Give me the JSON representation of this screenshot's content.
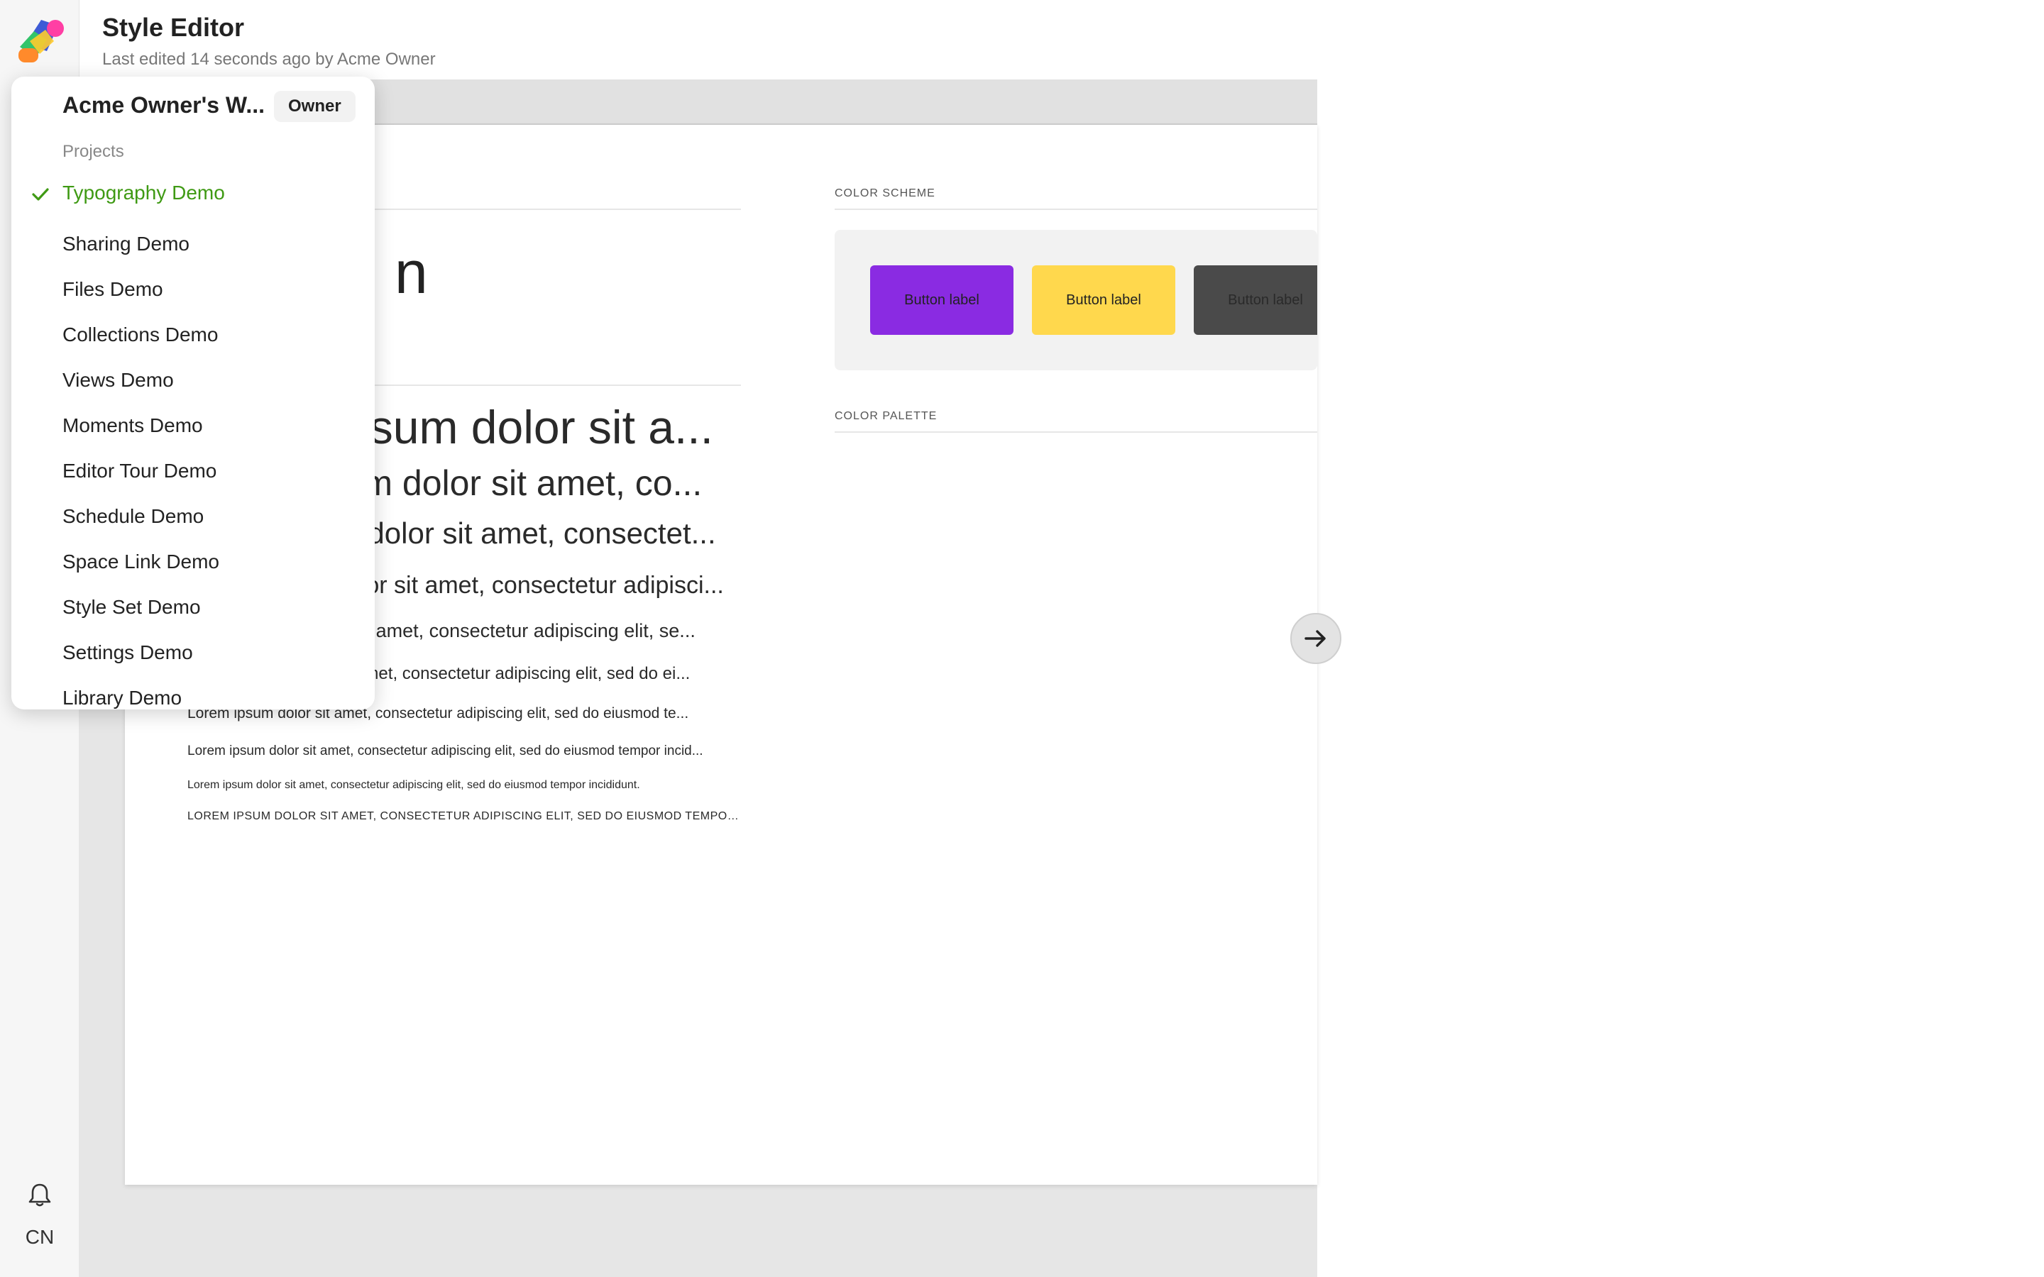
{
  "header": {
    "title": "Style Editor",
    "subtitle": "Last edited 14 seconds ago by Acme Owner"
  },
  "rail": {
    "initials": "CN"
  },
  "workspace_menu": {
    "workspace_name": "Acme Owner's W...",
    "role_badge": "Owner",
    "section_label": "Projects",
    "items": [
      {
        "label": "Typography Demo",
        "selected": true
      },
      {
        "label": "Sharing Demo"
      },
      {
        "label": "Files Demo"
      },
      {
        "label": "Collections Demo"
      },
      {
        "label": "Views Demo"
      },
      {
        "label": "Moments Demo"
      },
      {
        "label": "Editor Tour Demo"
      },
      {
        "label": "Schedule Demo"
      },
      {
        "label": "Space Link Demo"
      },
      {
        "label": "Style Set Demo"
      },
      {
        "label": "Settings Demo"
      },
      {
        "label": "Library Demo"
      }
    ]
  },
  "typography": {
    "glyph": "n",
    "samples": [
      "Lorem ipsum dolor sit a...",
      "Lorem ipsum dolor sit amet, co...",
      "Lorem ipsum dolor sit amet, consectet...",
      "Lorem ipsum dolor sit amet, consectetur adipisci...",
      "Lorem ipsum dolor sit amet, consectetur adipiscing elit, se...",
      "Lorem ipsum dolor sit amet, consectetur adipiscing elit, sed do ei...",
      "Lorem ipsum dolor sit amet, consectetur adipiscing elit, sed do eiusmod te...",
      "Lorem ipsum dolor sit amet, consectetur adipiscing elit, sed do eiusmod tempor incid...",
      "Lorem ipsum dolor sit amet, consectetur adipiscing elit, sed do eiusmod tempor incididunt.",
      "LOREM IPSUM DOLOR SIT AMET, CONSECTETUR ADIPISCING ELIT, SED DO EIUSMOD TEMPOR..."
    ]
  },
  "color_scheme": {
    "label": "COLOR SCHEME",
    "buttons": [
      {
        "label": "Button label",
        "bg": "#8a2be2"
      },
      {
        "label": "Button label",
        "bg": "#ffd84d"
      },
      {
        "label": "Button label",
        "bg": "#4a4a4a"
      }
    ]
  },
  "color_palette": {
    "label": "COLOR PALETTE"
  },
  "colors": {
    "accent_selected": "#3f9a14",
    "purple": "#8a2be2",
    "yellow": "#ffd84d",
    "dark": "#4a4a4a"
  },
  "icons": {
    "logo": "app-logo-icon",
    "bell": "bell-icon",
    "check": "check-icon",
    "arrow": "arrow-right-icon"
  }
}
